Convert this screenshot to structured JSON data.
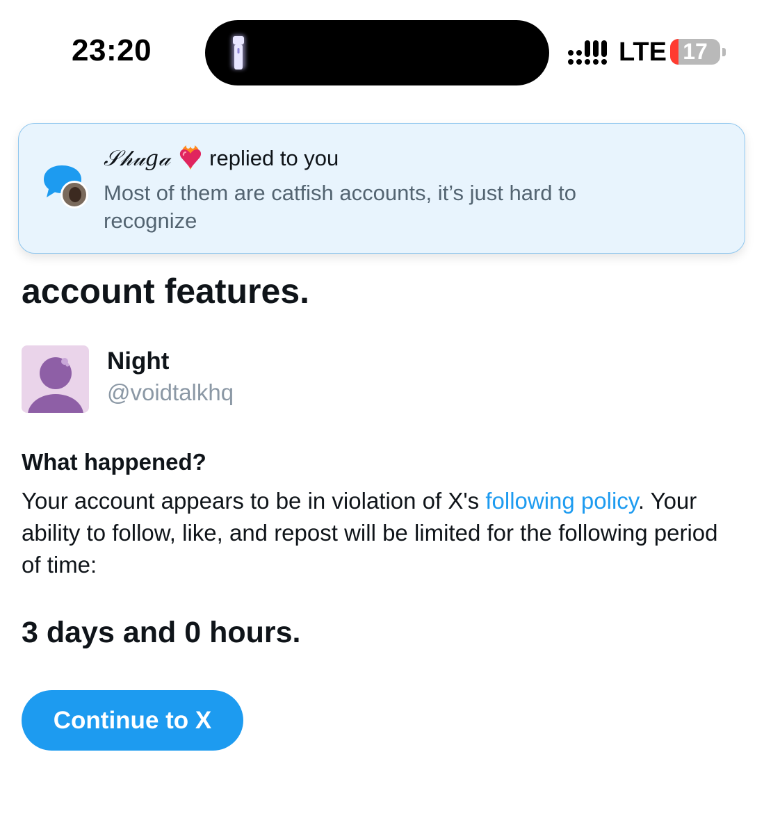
{
  "status_bar": {
    "time": "23:20",
    "network": "LTE",
    "battery_level": "17",
    "icons": [
      "flashlight-icon",
      "signal-icon",
      "battery-icon"
    ]
  },
  "notification": {
    "sender": "𝒮𝒽𝓊𝑔𝒶",
    "action": "replied to you",
    "message": "Most of them are catfish accounts, it’s just hard to recognize",
    "icons": [
      "reply-bubble-icon",
      "heart-on-fire-emoji"
    ]
  },
  "main": {
    "heading": "account features.",
    "account": {
      "name": "Night",
      "handle": "@voidtalkhq"
    },
    "section_title": "What happened?",
    "body_before_link": "Your account appears to be in violation of X's ",
    "link_text": "following policy",
    "body_after_link": ". Your ability to follow, like, and repost will be limited for the following period of time:",
    "duration": "3 days and 0 hours.",
    "continue_label": "Continue to X"
  },
  "colors": {
    "accent": "#1d9bf0",
    "notification_bg": "#e8f4fd",
    "muted_text": "#536471",
    "handle_text": "#8b98a5",
    "battery_low": "#ff3b30"
  }
}
